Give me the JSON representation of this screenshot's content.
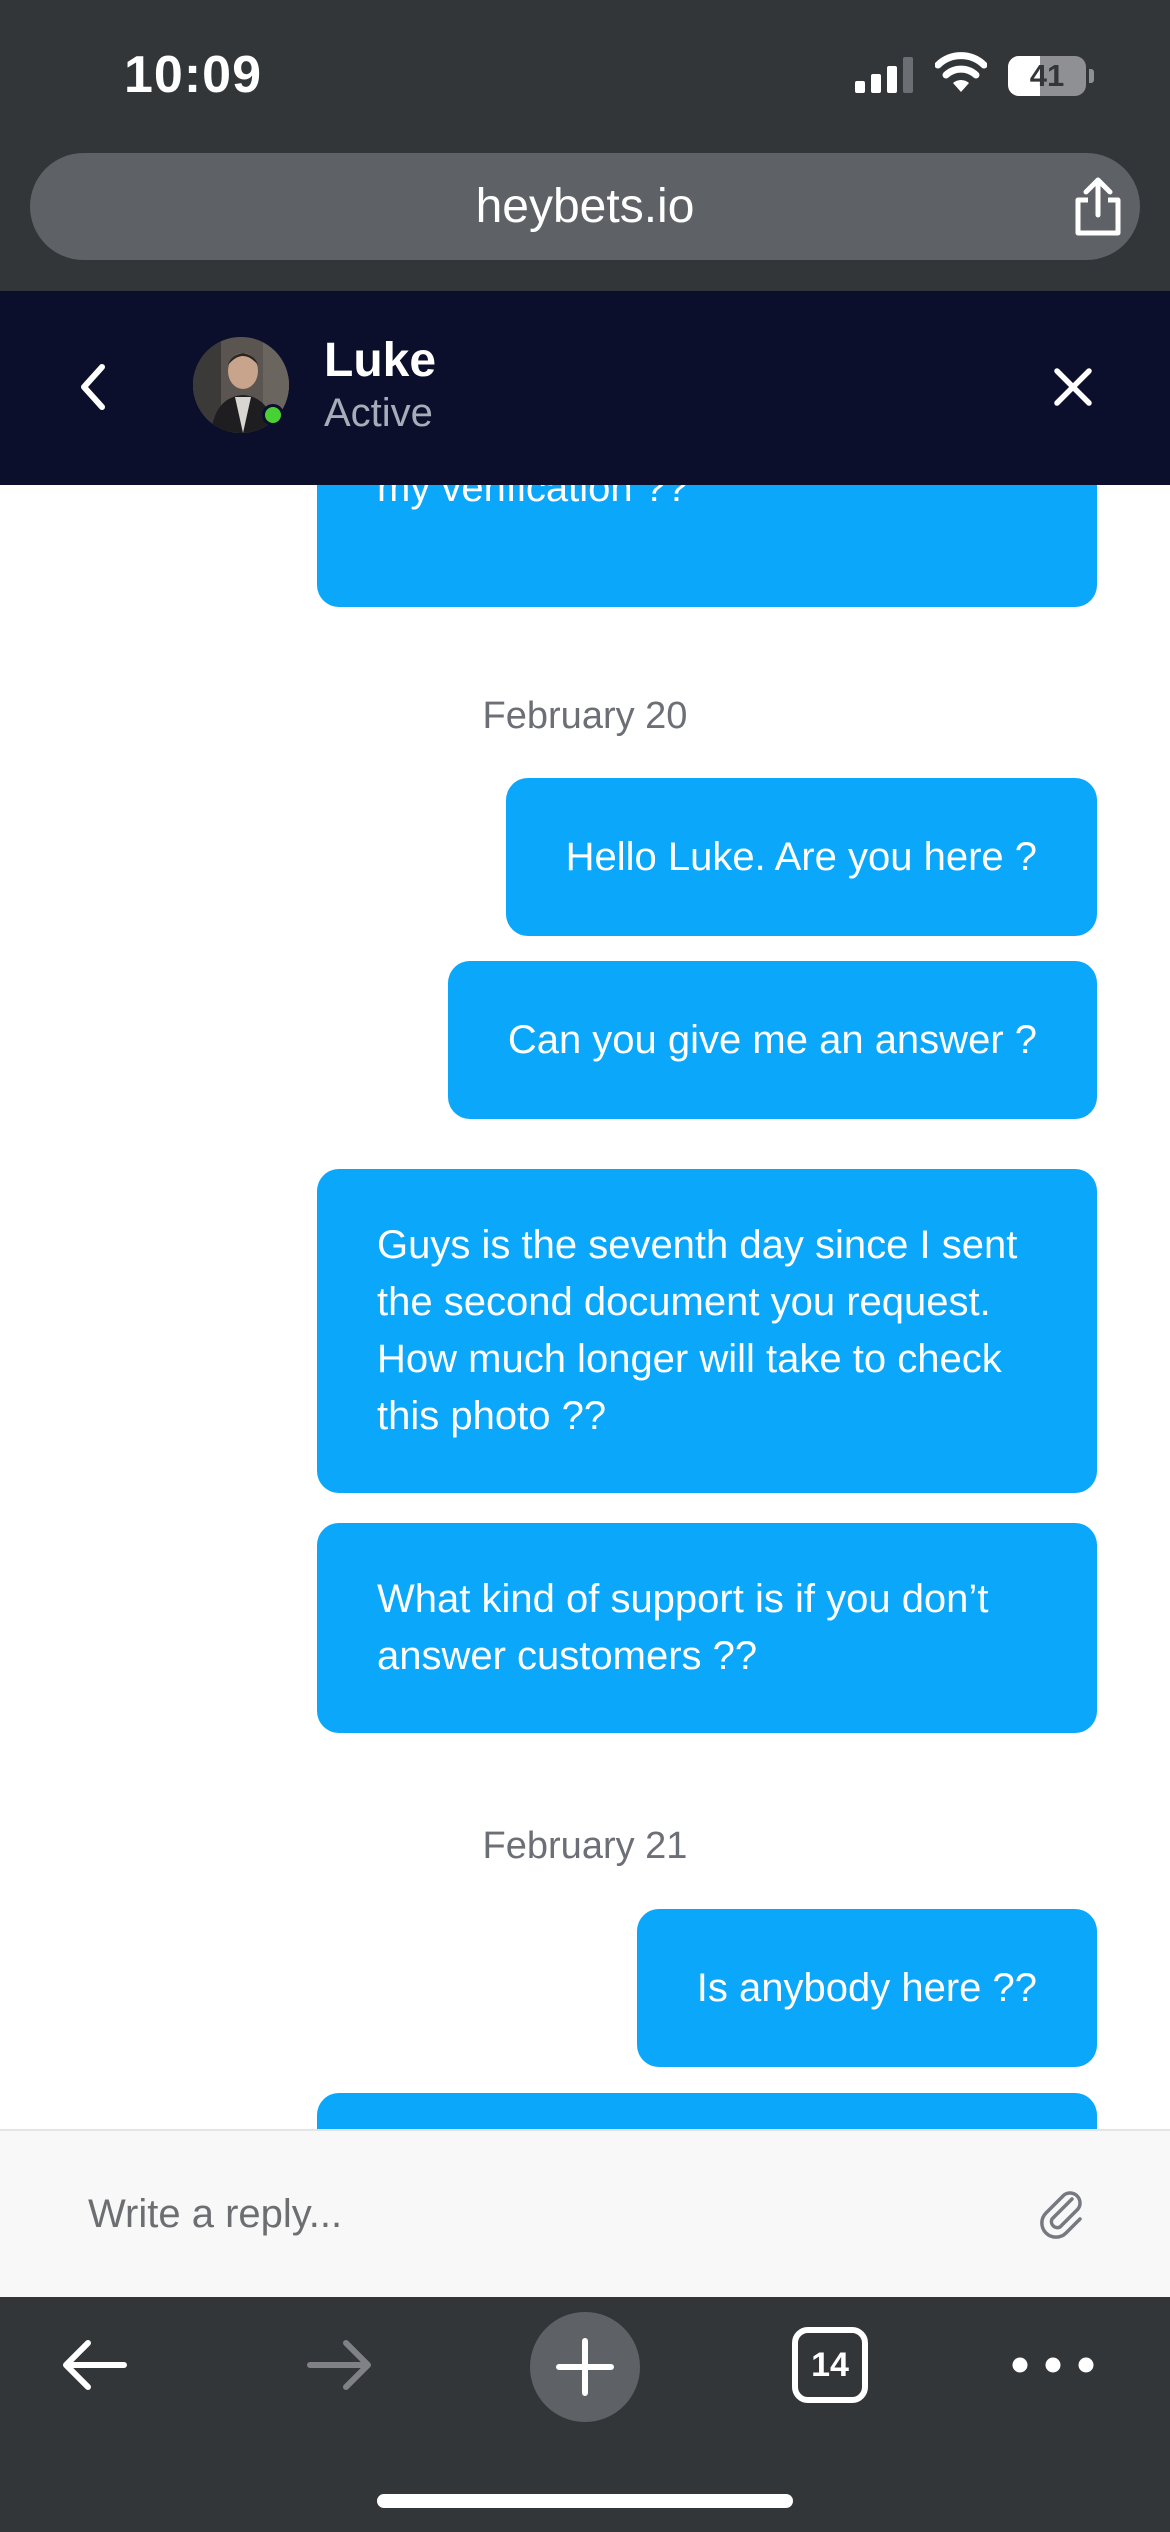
{
  "status_bar": {
    "time": "10:09",
    "battery_level": "41",
    "icons": [
      "cellular-signal-icon",
      "wifi-icon",
      "battery-icon"
    ]
  },
  "browser": {
    "url": "heybets.io",
    "share_icon": "share-icon",
    "tab_count": "14",
    "toolbar_icons": [
      "back-arrow-icon",
      "forward-arrow-icon",
      "plus-icon",
      "tabs-icon",
      "more-dots-icon"
    ]
  },
  "chat": {
    "agent_name": "Luke",
    "agent_status": "Active",
    "status_color": "#48d035",
    "accent_color": "#0aa7fb",
    "header_color": "#0b0f2c",
    "messages": [
      {
        "text": "my verification ??"
      },
      {
        "date": "February 20"
      },
      {
        "text": "Hello Luke. Are you here ?"
      },
      {
        "text": "Can you give me an answer ?"
      },
      {
        "text": "Guys is the seventh day since I sent the second document you request. How much longer will take to check this photo ??"
      },
      {
        "text": "What kind of support is if you don’t answer customers ??"
      },
      {
        "date": "February 21"
      },
      {
        "text": "Is anybody here ??"
      }
    ]
  },
  "reply": {
    "placeholder": "Write a reply..."
  }
}
